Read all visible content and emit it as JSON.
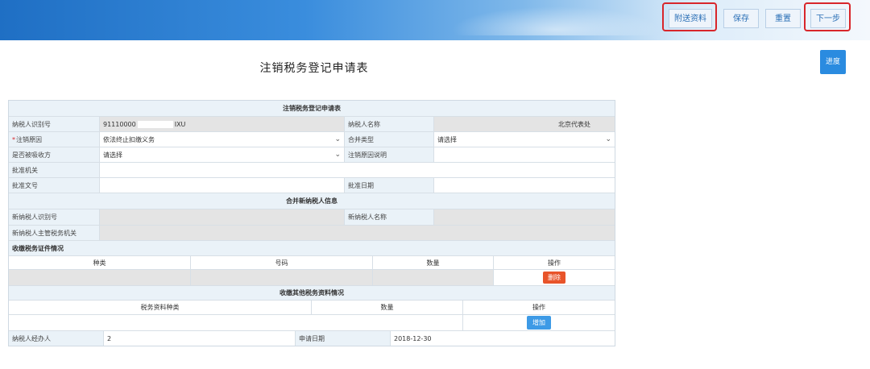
{
  "toolbar": {
    "attach_label": "附送资料",
    "save_label": "保存",
    "reset_label": "重置",
    "next_label": "下一步"
  },
  "page": {
    "title": "注销税务登记申请表",
    "progress_label": "进度"
  },
  "form": {
    "section_main": "注销税务登记申请表",
    "taxpayer_id_label": "纳税人识别号",
    "taxpayer_id_prefix": "91110000",
    "taxpayer_id_suffix": "IXU",
    "taxpayer_name_label": "纳税人名称",
    "taxpayer_name_value": "北京代表处",
    "cancel_reason_label": "注销原因",
    "cancel_reason_value": "依法终止扣缴义务",
    "merge_type_label": "合并类型",
    "merge_type_value": "请选择",
    "is_merged_label": "是否被吸收方",
    "is_merged_value": "请选择",
    "cancel_reason_desc_label": "注销原因说明",
    "approval_org_label": "批准机关",
    "approval_doc_label": "批准文号",
    "approval_date_label": "批准日期",
    "section_merge": "合并新纳税人信息",
    "new_taxpayer_id_label": "新纳税人识别号",
    "new_taxpayer_name_label": "新纳税人名称",
    "new_tax_authority_label": "新纳税人主管税务机关",
    "section_cert": "收缴税务证件情况",
    "cert_headers": [
      "种类",
      "号码",
      "数量",
      "操作"
    ],
    "delete_label": "删除",
    "section_other": "收缴其他税务资料情况",
    "other_headers": [
      "税务资料种类",
      "数量",
      "操作"
    ],
    "add_label": "增加",
    "agent_label": "纳税人经办人",
    "agent_value": "2",
    "apply_date_label": "申请日期",
    "apply_date_value": "2018-12-30"
  },
  "icons": {
    "dropdown": "chevron-down-icon"
  },
  "colors": {
    "highlight": "#d8262b",
    "delete_button": "#e8542a",
    "add_button": "#3d9ae6",
    "progress_button": "#2a8be0"
  }
}
